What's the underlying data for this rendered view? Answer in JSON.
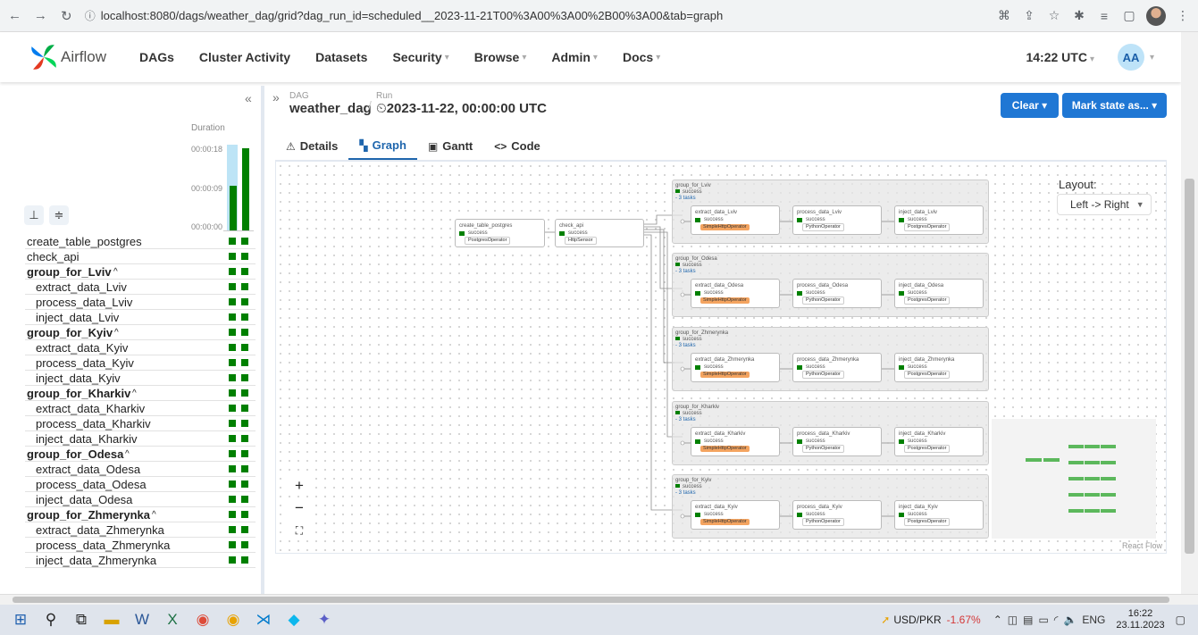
{
  "browser": {
    "url": "localhost:8080/dags/weather_dag/grid?dag_run_id=scheduled__2023-11-21T00%3A00%3A00%2B00%3A00&tab=graph"
  },
  "nav": {
    "logo_text": "Airflow",
    "items": [
      {
        "label": "DAGs",
        "dropdown": false
      },
      {
        "label": "Cluster Activity",
        "dropdown": false
      },
      {
        "label": "Datasets",
        "dropdown": false
      },
      {
        "label": "Security",
        "dropdown": true
      },
      {
        "label": "Browse",
        "dropdown": true
      },
      {
        "label": "Admin",
        "dropdown": true
      },
      {
        "label": "Docs",
        "dropdown": true
      }
    ],
    "time": "14:22 UTC",
    "avatar": "AA"
  },
  "left": {
    "duration_label": "Duration",
    "ticks": [
      "00:00:18",
      "00:00:09",
      "00:00:00"
    ],
    "tasks": [
      {
        "name": "create_table_postgres",
        "type": "task"
      },
      {
        "name": "check_api",
        "type": "task"
      },
      {
        "name": "group_for_Lviv",
        "type": "group"
      },
      {
        "name": "extract_data_Lviv",
        "type": "child"
      },
      {
        "name": "process_data_Lviv",
        "type": "child"
      },
      {
        "name": "inject_data_Lviv",
        "type": "child"
      },
      {
        "name": "group_for_Kyiv",
        "type": "group"
      },
      {
        "name": "extract_data_Kyiv",
        "type": "child"
      },
      {
        "name": "process_data_Kyiv",
        "type": "child"
      },
      {
        "name": "inject_data_Kyiv",
        "type": "child"
      },
      {
        "name": "group_for_Kharkiv",
        "type": "group"
      },
      {
        "name": "extract_data_Kharkiv",
        "type": "child"
      },
      {
        "name": "process_data_Kharkiv",
        "type": "child"
      },
      {
        "name": "inject_data_Kharkiv",
        "type": "child"
      },
      {
        "name": "group_for_Odesa",
        "type": "group"
      },
      {
        "name": "extract_data_Odesa",
        "type": "child"
      },
      {
        "name": "process_data_Odesa",
        "type": "child"
      },
      {
        "name": "inject_data_Odesa",
        "type": "child"
      },
      {
        "name": "group_for_Zhmerynka",
        "type": "group"
      },
      {
        "name": "extract_data_Zhmerynka",
        "type": "child"
      },
      {
        "name": "process_data_Zhmerynka",
        "type": "child"
      },
      {
        "name": "inject_data_Zhmerynka",
        "type": "child"
      }
    ]
  },
  "header": {
    "dag_label": "DAG",
    "dag_name": "weather_dag",
    "run_label": "Run",
    "run_value": "2023-11-22, 00:00:00 UTC",
    "clear_label": "Clear",
    "mark_label": "Mark state as..."
  },
  "tabs": [
    {
      "label": "Details",
      "icon": "⚠"
    },
    {
      "label": "Graph",
      "icon": "▚"
    },
    {
      "label": "Gantt",
      "icon": "▣"
    },
    {
      "label": "Code",
      "icon": "<>"
    }
  ],
  "graph": {
    "layout_label": "Layout:",
    "layout_value": "Left -> Right",
    "react_flow": "React Flow",
    "status": "success",
    "tasks_label": "- 3 tasks",
    "root_nodes": [
      {
        "name": "create_table_postgres",
        "operator": "PostgresOperator"
      },
      {
        "name": "check_api",
        "operator": "HttpSensor"
      }
    ],
    "groups": [
      {
        "name": "group_for_Lviv",
        "city": "Lviv"
      },
      {
        "name": "group_for_Odesa",
        "city": "Odesa"
      },
      {
        "name": "group_for_Zhmerynka",
        "city": "Zhmerynka"
      },
      {
        "name": "group_for_Kharkiv",
        "city": "Kharkiv"
      },
      {
        "name": "group_for_Kyiv",
        "city": "Kyiv"
      }
    ],
    "operators": {
      "extract": "SimpleHttpOperator",
      "process": "PythonOperator",
      "inject": "PostgresOperator"
    },
    "zoom_in": "+",
    "zoom_out": "−",
    "fit": "⛶"
  },
  "taskbar": {
    "ticker_label": "USD/PKR",
    "ticker_change": "-1.67%",
    "lang": "ENG",
    "time": "16:22",
    "date": "23.11.2023"
  },
  "colors": {
    "success": "#008000",
    "primary": "#1f77d4",
    "http_operator": "#f4a460"
  }
}
